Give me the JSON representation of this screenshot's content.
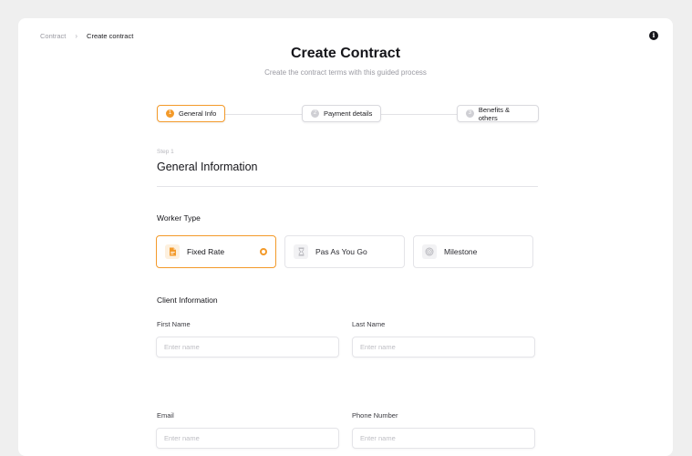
{
  "breadcrumb": {
    "items": [
      "Contract",
      "Create contract"
    ],
    "separator": "›"
  },
  "header": {
    "title": "Create Contract",
    "subtitle": "Create the contract terms with this guided process",
    "info_icon": "i"
  },
  "stepper": {
    "steps": [
      {
        "number": "1",
        "label": "General Info",
        "active": true
      },
      {
        "number": "2",
        "label": "Payment details",
        "active": false
      },
      {
        "number": "3",
        "label": "Benefits & others",
        "active": false
      }
    ]
  },
  "section": {
    "step_label": "Step 1",
    "title": "General Information"
  },
  "worker_type": {
    "heading": "Worker Type",
    "options": [
      {
        "label": "Fixed Rate",
        "icon": "document-icon",
        "selected": true
      },
      {
        "label": "Pas As You Go",
        "icon": "hourglass-icon",
        "selected": false
      },
      {
        "label": "Milestone",
        "icon": "target-icon",
        "selected": false
      }
    ]
  },
  "client_info": {
    "heading": "Client Information",
    "fields": {
      "first_name": {
        "label": "First Name",
        "placeholder": "Enter name",
        "value": ""
      },
      "last_name": {
        "label": "Last Name",
        "placeholder": "Enter name",
        "value": ""
      },
      "email": {
        "label": "Email",
        "placeholder": "Enter name",
        "value": ""
      },
      "phone": {
        "label": "Phone Number",
        "placeholder": "Enter name",
        "value": ""
      }
    }
  },
  "colors": {
    "accent": "#f39a2a",
    "background": "#efefef",
    "card": "#ffffff",
    "text": "#15151a"
  }
}
